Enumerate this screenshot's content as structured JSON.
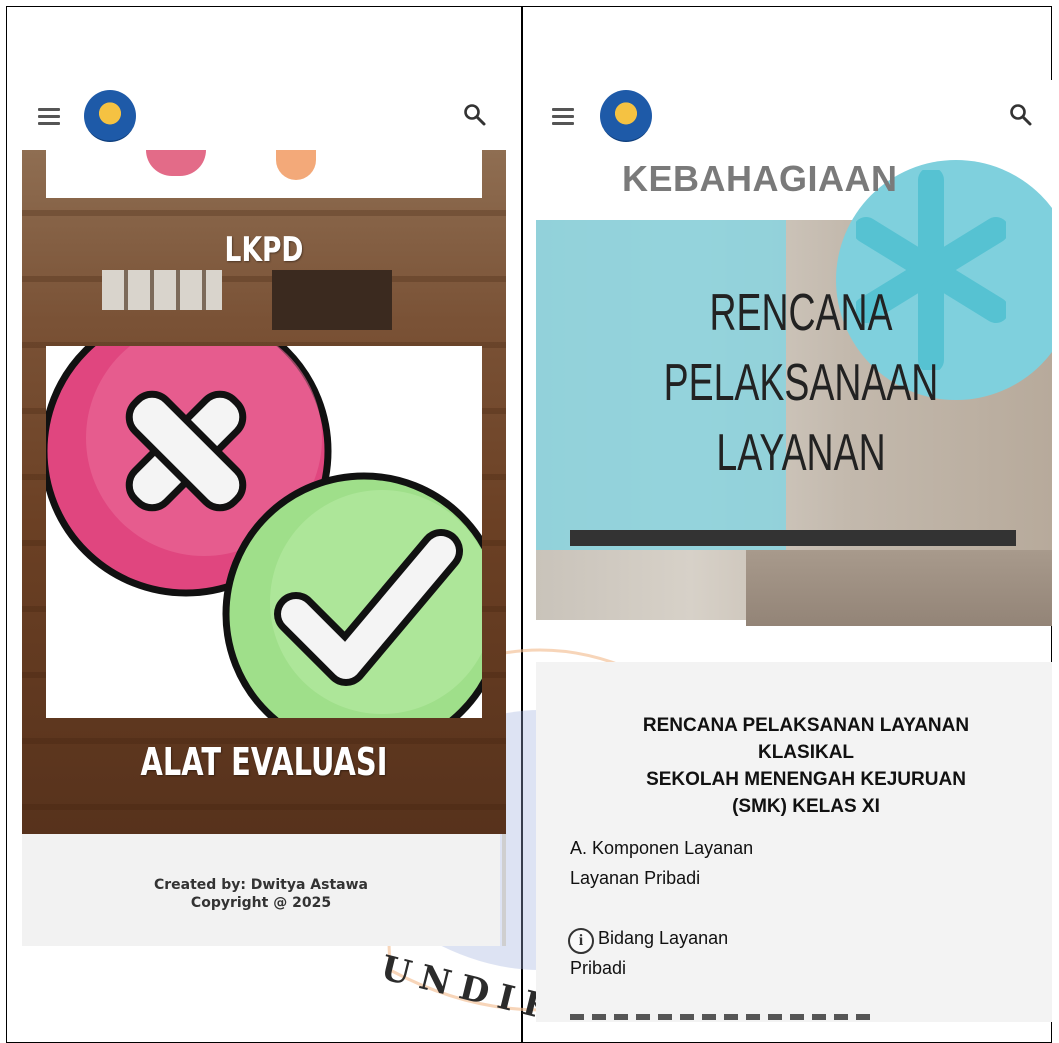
{
  "left_phone": {
    "header": {
      "menu_icon": "hamburger-icon",
      "logo_icon": "institution-logo",
      "search_icon": "search-icon"
    },
    "sections": {
      "lkpd_label": "LKPD",
      "evaluation_label": "ALAT EVALUASI"
    },
    "footer": {
      "created_by": "Created by: Dwitya Astawa",
      "copyright": "Copyright @ 2025"
    }
  },
  "right_phone": {
    "header": {
      "menu_icon": "hamburger-icon",
      "logo_icon": "institution-logo",
      "search_icon": "search-icon"
    },
    "hero": {
      "top_word": "KEBAHAGIAAN",
      "title_line1": "RENCANA",
      "title_line2": "PELAKSANAAN",
      "title_line3": "LAYANAN"
    },
    "document": {
      "heading_line1": "RENCANA PELAKSANAN LAYANAN",
      "heading_line2": "KLASIKAL",
      "heading_line3": "SEKOLAH MENENGAH KEJURUAN",
      "heading_line4": "(SMK) KELAS XI",
      "item_a_label": "A. Komponen Layanan",
      "item_a_value": "Layanan Pribadi",
      "item_b_label": "Bidang Layanan",
      "item_b_value": "Pribadi"
    }
  },
  "watermark": {
    "text": "UNDIK"
  },
  "colors": {
    "pink": "#e0467f",
    "green": "#9fdf8a",
    "cyan": "#7fd0dd",
    "footer_bg": "#f2f2f2"
  }
}
